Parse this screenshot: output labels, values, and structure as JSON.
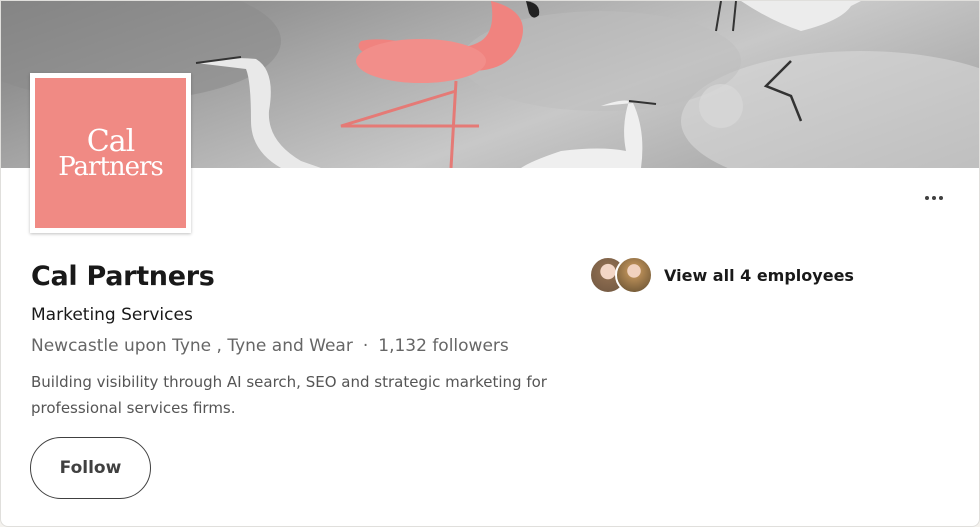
{
  "company": {
    "name": "Cal Partners",
    "industry": "Marketing Services",
    "location": "Newcastle upon Tyne , Tyne and Wear",
    "separator": "·",
    "followers": "1,132 followers",
    "tagline": "Building visibility through AI search, SEO and strategic marketing for professional services firms."
  },
  "logo": {
    "line1": "Cal",
    "line2": "Partners",
    "background": "#f08a84"
  },
  "actions": {
    "follow_label": "Follow",
    "more_icon": "ellipsis-icon"
  },
  "employees": {
    "label": "View all 4 employees"
  },
  "colors": {
    "flamingo": "#f0837f",
    "text_primary": "#191919",
    "text_secondary": "#666666"
  }
}
